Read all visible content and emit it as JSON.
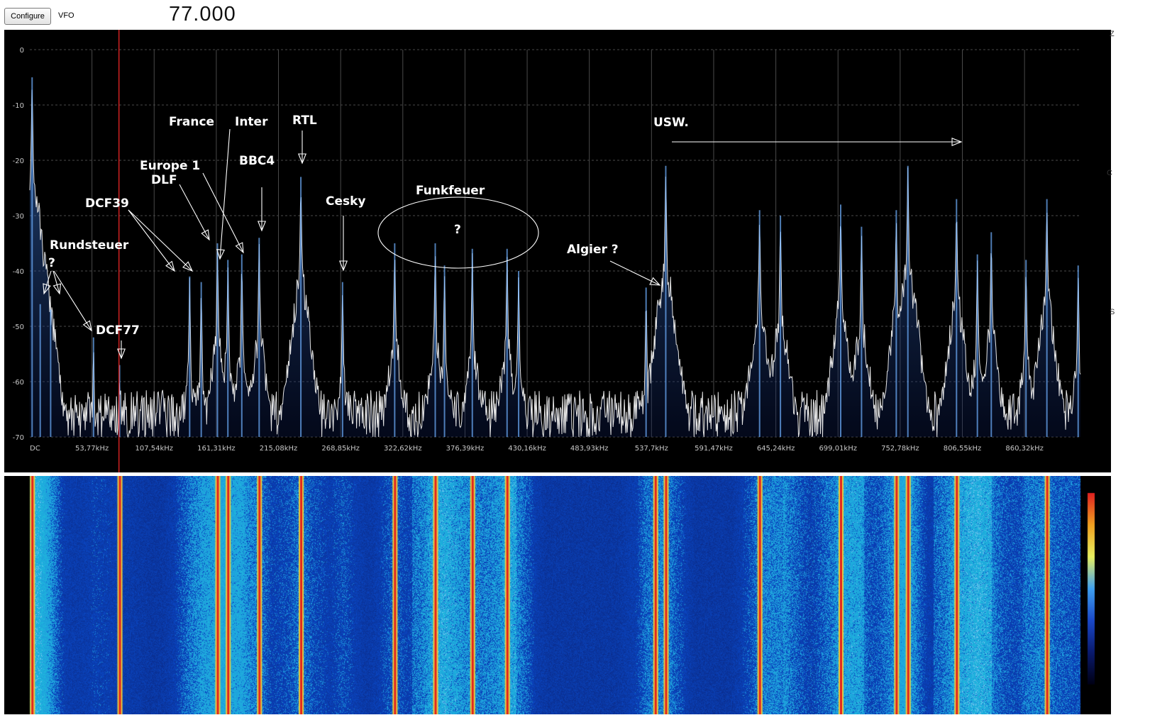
{
  "toolbar": {
    "configure_label": "Configure",
    "vfo_label": "VFO",
    "vfo_frequency": "77.000"
  },
  "spectrum": {
    "y_ticks": [
      "0",
      "-10",
      "-20",
      "-30",
      "-40",
      "-50",
      "-60",
      "-70"
    ],
    "y_range": [
      -70,
      0
    ],
    "x_ticks": [
      "DC",
      "53,77kHz",
      "107,54kHz",
      "161,31kHz",
      "215,08kHz",
      "268,85kHz",
      "322,62kHz",
      "376,39kHz",
      "430,16kHz",
      "483,93kHz",
      "537,7kHz",
      "591,47kHz",
      "645,24kHz",
      "699,01kHz",
      "752,78kHz",
      "806,55kHz",
      "860,32kHz"
    ],
    "x_range_khz": [
      0,
      907
    ],
    "marker_khz": 77.0,
    "noise_floor_db": -64,
    "trace_color": "#e6e6e6",
    "fill_color": "#2f6fd8",
    "marker_color": "#ff2a2a",
    "peaks": [
      {
        "khz": 2,
        "db": -5
      },
      {
        "khz": 9,
        "db": -46
      },
      {
        "khz": 18,
        "db": -47
      },
      {
        "khz": 55,
        "db": -52
      },
      {
        "khz": 77.5,
        "db": -57
      },
      {
        "khz": 138,
        "db": -41
      },
      {
        "khz": 148,
        "db": -42
      },
      {
        "khz": 162,
        "db": -35
      },
      {
        "khz": 171,
        "db": -38
      },
      {
        "khz": 183,
        "db": -37
      },
      {
        "khz": 198,
        "db": -34
      },
      {
        "khz": 234,
        "db": -23
      },
      {
        "khz": 270,
        "db": -42
      },
      {
        "khz": 315,
        "db": -35
      },
      {
        "khz": 350,
        "db": -35
      },
      {
        "khz": 358,
        "db": -39
      },
      {
        "khz": 382,
        "db": -36
      },
      {
        "khz": 412,
        "db": -36
      },
      {
        "khz": 422,
        "db": -40
      },
      {
        "khz": 532,
        "db": -43
      },
      {
        "khz": 549,
        "db": -21
      },
      {
        "khz": 630,
        "db": -29
      },
      {
        "khz": 648,
        "db": -30
      },
      {
        "khz": 700,
        "db": -28
      },
      {
        "khz": 718,
        "db": -32
      },
      {
        "khz": 748,
        "db": -29
      },
      {
        "khz": 758,
        "db": -21
      },
      {
        "khz": 800,
        "db": -27
      },
      {
        "khz": 818,
        "db": -37
      },
      {
        "khz": 830,
        "db": -33
      },
      {
        "khz": 860,
        "db": -38
      },
      {
        "khz": 878,
        "db": -27
      },
      {
        "khz": 905,
        "db": -39
      }
    ]
  },
  "annotations": {
    "rundsteuer": "Rundsteuer",
    "rundsteuer_q": "?",
    "dcf77": "DCF77",
    "dcf39": "DCF39",
    "europe1": "Europe 1",
    "dlf": "DLF",
    "france": "France",
    "inter": "Inter",
    "bbc4": "BBC4",
    "rtl": "RTL",
    "cesky": "Cesky",
    "funkfeuer": "Funkfeuer",
    "funkfeuer_q": "?",
    "algier": "Algier ?",
    "usw": "USW."
  },
  "waterfall": {
    "strong_lines_khz": [
      2,
      77.5,
      162,
      171,
      198,
      234,
      315,
      350,
      382,
      412,
      540,
      549,
      630,
      700,
      748,
      758,
      800,
      878
    ],
    "colormap": [
      "#000014",
      "#0a1a6e",
      "#1a48c8",
      "#3fa0f0",
      "#e8f060",
      "#f0a020",
      "#e02020"
    ]
  },
  "right_edge": [
    "Z",
    "C",
    "S"
  ]
}
